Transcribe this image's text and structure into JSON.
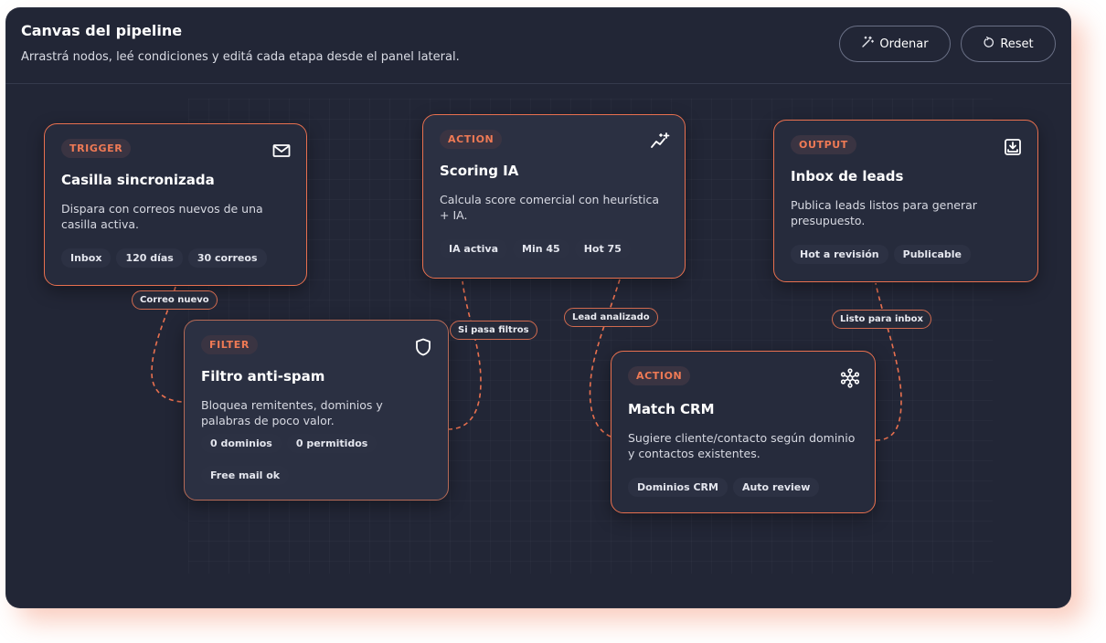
{
  "header": {
    "title": "Canvas del pipeline",
    "subtitle": "Arrastrá nodos, leé condiciones y editá cada etapa desde el panel lateral.",
    "ordenar_label": "Ordenar",
    "ordenar_icon": "magic-wand-icon",
    "reset_label": "Reset",
    "reset_icon": "refresh-icon"
  },
  "colors": {
    "accent": "#e8704f",
    "background": "#222636",
    "node": "#262b3c"
  },
  "nodes": [
    {
      "id": "trigger",
      "badge": "TRIGGER",
      "icon": "mail-icon",
      "title": "Casilla sincronizada",
      "description": "Dispara con correos nuevos de una casilla activa.",
      "tags": [
        "Inbox",
        "120 días",
        "30 correos"
      ]
    },
    {
      "id": "filter",
      "badge": "FILTER",
      "icon": "shield-icon",
      "title": "Filtro anti-spam",
      "description": "Bloquea remitentes, dominios y palabras de poco valor.",
      "tags": [
        "0 dominios",
        "0 permitidos",
        "Free mail ok"
      ]
    },
    {
      "id": "scoring",
      "badge": "ACTION",
      "icon": "trend-sparkle-icon",
      "title": "Scoring IA",
      "description": "Calcula score comercial con heurística + IA.",
      "tags": [
        "IA activa",
        "Min 45",
        "Hot 75"
      ]
    },
    {
      "id": "match",
      "badge": "ACTION",
      "icon": "network-icon",
      "title": "Match CRM",
      "description": "Sugiere cliente/contacto según dominio y contactos existentes.",
      "tags": [
        "Dominios CRM",
        "Auto review"
      ]
    },
    {
      "id": "output",
      "badge": "OUTPUT",
      "icon": "download-tray-icon",
      "title": "Inbox de leads",
      "description": "Publica leads listos para generar presupuesto.",
      "tags": [
        "Hot a revisión",
        "Publicable"
      ]
    }
  ],
  "edges": [
    {
      "label": "Correo nuevo"
    },
    {
      "label": "Si pasa filtros"
    },
    {
      "label": "Lead analizado"
    },
    {
      "label": "Listo para inbox"
    }
  ]
}
